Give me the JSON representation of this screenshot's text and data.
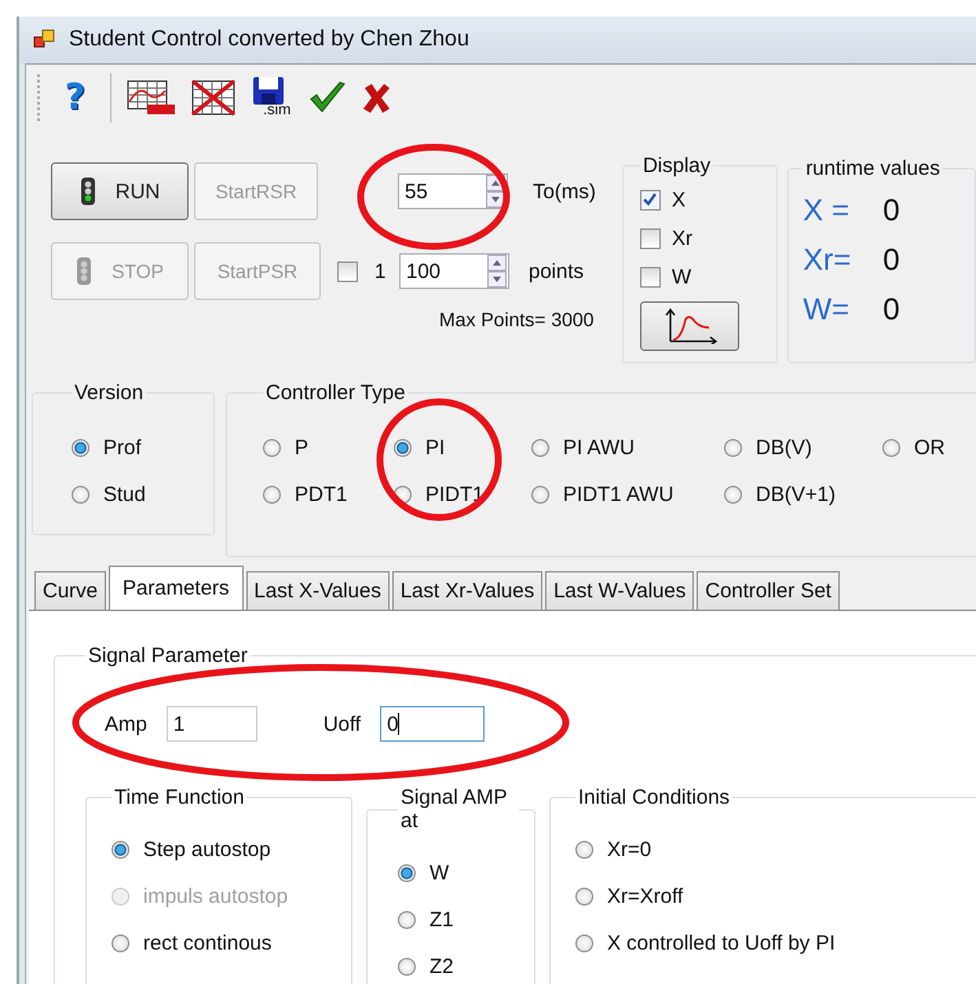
{
  "window": {
    "title": "Student Control converted by Chen Zhou"
  },
  "toolbar": {
    "help": "?",
    "save_caption": ".sim"
  },
  "buttons": [
    {
      "label": "RUN",
      "kind": "light",
      "disabled": false
    },
    {
      "label": "StartRSR",
      "kind": "plain",
      "disabled": true
    },
    {
      "label": "STOP",
      "kind": "light",
      "disabled": true
    },
    {
      "label": "StartPSR",
      "kind": "plain",
      "disabled": true
    }
  ],
  "sample_time": {
    "value": "55",
    "unit": "To(ms)"
  },
  "points": {
    "checkbox_label": "1",
    "checked": false,
    "value": "100",
    "unit": "points",
    "max_label": "Max Points= 3000"
  },
  "display": {
    "title": "Display",
    "options": [
      {
        "label": "X",
        "checked": true
      },
      {
        "label": "Xr",
        "checked": false
      },
      {
        "label": "W",
        "checked": false
      }
    ]
  },
  "runtime_values": {
    "title": "runtime values",
    "rows": [
      {
        "label": "X =",
        "value": "0"
      },
      {
        "label": "Xr=",
        "value": "0"
      },
      {
        "label": "W=",
        "value": "0"
      }
    ]
  },
  "version": {
    "title": "Version",
    "options": [
      {
        "label": "Prof",
        "selected": true
      },
      {
        "label": "Stud",
        "selected": false
      }
    ]
  },
  "controller_type": {
    "title": "Controller Type",
    "options": [
      {
        "label": "P",
        "selected": false
      },
      {
        "label": "PI",
        "selected": true
      },
      {
        "label": "PI AWU",
        "selected": false
      },
      {
        "label": "DB(V)",
        "selected": false
      },
      {
        "label": "OR",
        "selected": false
      },
      {
        "label": "PDT1",
        "selected": false
      },
      {
        "label": "PIDT1",
        "selected": false
      },
      {
        "label": "PIDT1 AWU",
        "selected": false
      },
      {
        "label": "DB(V+1)",
        "selected": false
      }
    ]
  },
  "tabs": [
    {
      "label": "Curve",
      "selected": false
    },
    {
      "label": "Parameters",
      "selected": true
    },
    {
      "label": "Last X-Values",
      "selected": false
    },
    {
      "label": "Last Xr-Values",
      "selected": false
    },
    {
      "label": "Last W-Values",
      "selected": false
    },
    {
      "label": "Controller Set",
      "selected": false
    }
  ],
  "signal_parameter": {
    "title": "Signal Parameter",
    "amp": {
      "label": "Amp",
      "value": "1",
      "focused": false
    },
    "uoff": {
      "label": "Uoff",
      "value": "0",
      "focused": true
    }
  },
  "time_function": {
    "title": "Time Function",
    "options": [
      {
        "label": "Step autostop",
        "selected": true,
        "disabled": false
      },
      {
        "label": "impuls autostop",
        "selected": false,
        "disabled": true
      },
      {
        "label": "rect continous",
        "selected": false,
        "disabled": false
      }
    ]
  },
  "signal_amp": {
    "title": "Signal AMP at",
    "options": [
      {
        "label": "W",
        "selected": true,
        "disabled": false
      },
      {
        "label": "Z1",
        "selected": false,
        "disabled": false
      },
      {
        "label": "Z2",
        "selected": false,
        "disabled": false
      }
    ]
  },
  "initial_conditions": {
    "title": "Initial Conditions",
    "options": [
      {
        "label": "Xr=0",
        "selected": false,
        "disabled": false
      },
      {
        "label": "Xr=Xroff",
        "selected": false,
        "disabled": false
      },
      {
        "label": "X controlled to Uoff by PI",
        "selected": false,
        "disabled": false
      }
    ]
  }
}
